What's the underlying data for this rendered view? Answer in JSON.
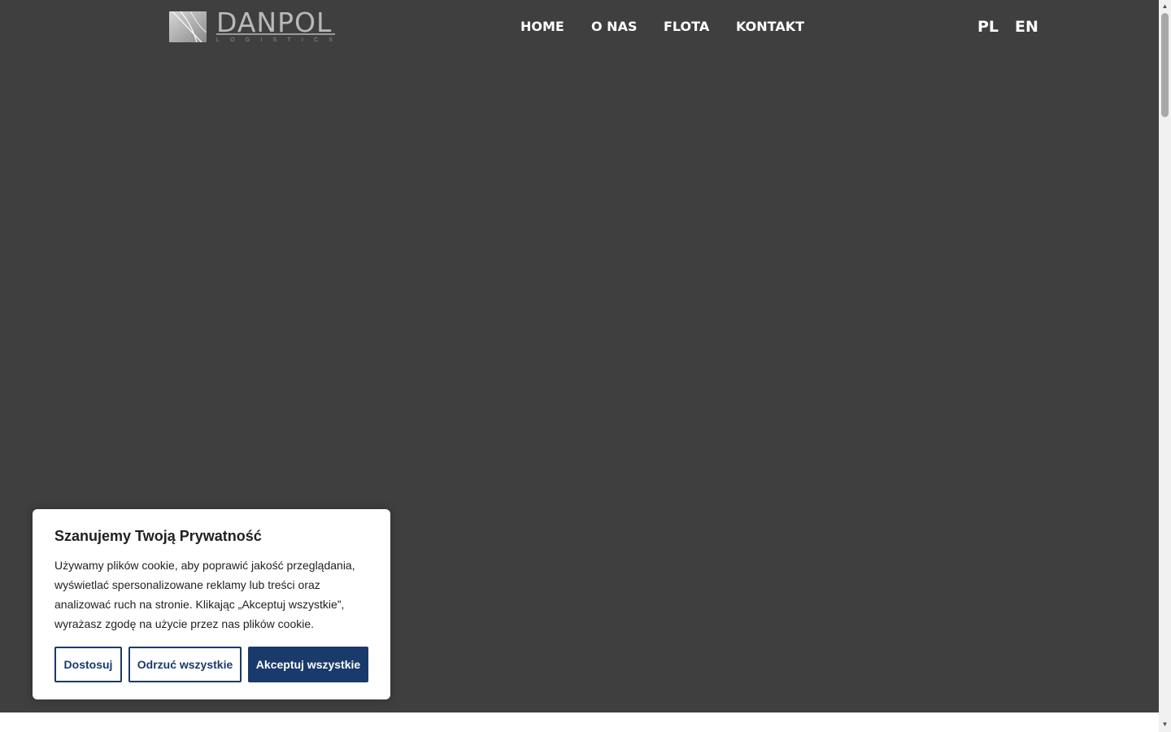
{
  "header": {
    "logo": {
      "name": "DANPOL",
      "tagline": "LOGISTICS"
    },
    "nav": [
      {
        "label": "HOME"
      },
      {
        "label": "O NAS"
      },
      {
        "label": "FLOTA"
      },
      {
        "label": "KONTAKT"
      }
    ],
    "languages": [
      {
        "label": "PL"
      },
      {
        "label": "EN"
      }
    ]
  },
  "cookie_banner": {
    "title": "Szanujemy Twoją Prywatność",
    "text": "Używamy plików cookie, aby poprawić jakość przeglądania, wyświetlać spersonalizowane reklamy lub treści oraz analizować ruch na stronie. Klikając „Akceptuj wszystkie”, wyrażasz zgodę na użycie przez nas plików cookie.",
    "buttons": {
      "customize": "Dostosuj",
      "reject_all": "Odrzuć wszystkie",
      "accept_all": "Akceptuj wszystkie"
    }
  },
  "colors": {
    "hero_background": "#3f3f3f",
    "accent": "#1a3a6b",
    "nav_text": "#ffffff"
  }
}
